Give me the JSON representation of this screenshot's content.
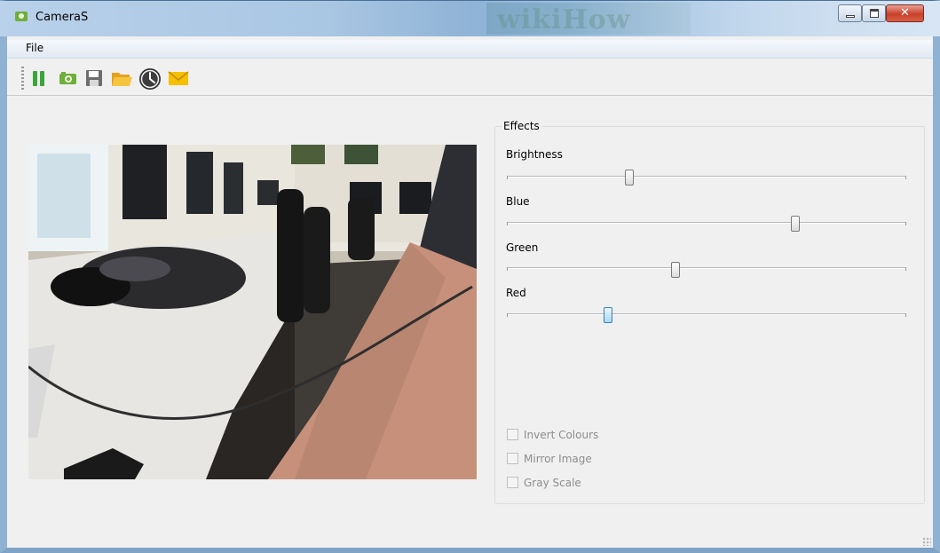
{
  "window": {
    "title": "CameraS",
    "watermark": "wikiHow"
  },
  "menu": {
    "items": [
      "File"
    ]
  },
  "toolbar": {
    "buttons": [
      {
        "name": "pause",
        "icon": "pause-icon"
      },
      {
        "name": "snapshot",
        "icon": "camera-icon"
      },
      {
        "name": "save",
        "icon": "floppy-disk-icon"
      },
      {
        "name": "open",
        "icon": "folder-icon"
      },
      {
        "name": "timer",
        "icon": "clock-icon"
      },
      {
        "name": "email",
        "icon": "envelope-icon"
      }
    ]
  },
  "effects": {
    "group_title": "Effects",
    "sliders": [
      {
        "label": "Brightness",
        "value_fraction": 0.3
      },
      {
        "label": "Blue",
        "value_fraction": 0.72
      },
      {
        "label": "Green",
        "value_fraction": 0.42
      },
      {
        "label": "Red",
        "value_fraction": 0.25,
        "focused": true
      }
    ],
    "checkboxes": [
      {
        "label": "Invert Colours",
        "checked": false,
        "enabled": false
      },
      {
        "label": "Mirror Image",
        "checked": false,
        "enabled": false
      },
      {
        "label": "Gray Scale",
        "checked": false,
        "enabled": false
      }
    ]
  },
  "colors": {
    "accent_green": "#3aa53a",
    "slider_focus": "#3c7fb1",
    "disabled_text": "#8d8d8d"
  }
}
